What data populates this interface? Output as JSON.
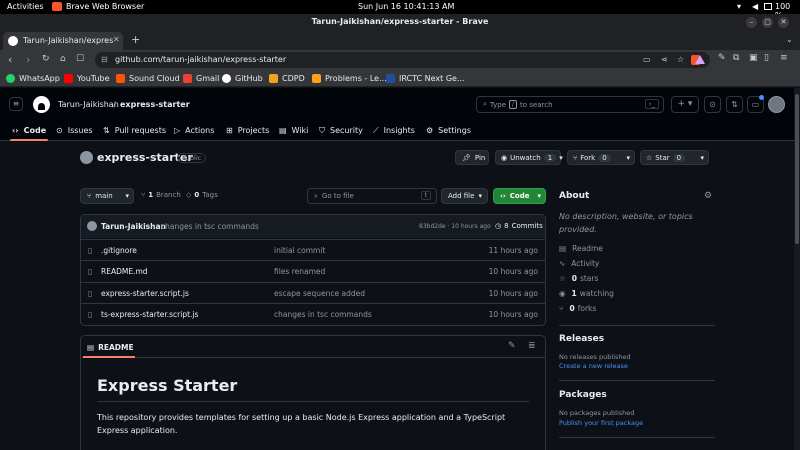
{
  "os_bar": {
    "activities": "Activities",
    "app_name": "Brave Web Browser",
    "datetime": "Sun Jun 16  10:41:13 AM",
    "battery": "100 %"
  },
  "browser": {
    "window_title": "Tarun-Jaikishan/express-starter - Brave",
    "tab_title": "Tarun-Jaikishan/expres",
    "url": "github.com/tarun-jaikishan/express-starter",
    "bookmarks": [
      "WhatsApp",
      "YouTube",
      "Sound Cloud",
      "Gmail",
      "GitHub",
      "CDPD",
      "Problems - Le...",
      "IRCTC Next Ge..."
    ],
    "bookmark_colors": [
      "#25d366",
      "#ff0000",
      "#ff5500",
      "#ea4335",
      "#ffffff",
      "#f4a21b",
      "#ffa116",
      "#1f4e9c"
    ]
  },
  "github": {
    "owner": "Tarun-Jaikishan",
    "separator": "/",
    "repo": "express-starter",
    "search_placeholder_a": "Type",
    "search_key": "/",
    "search_placeholder_b": "to search",
    "repo_tabs": [
      "Code",
      "Issues",
      "Pull requests",
      "Actions",
      "Projects",
      "Wiki",
      "Security",
      "Insights",
      "Settings"
    ],
    "repo_title": "express-starter",
    "visibility": "Public",
    "pin_label": "Pin",
    "unwatch_label": "Unwatch",
    "watch_count": "1",
    "fork_label": "Fork",
    "fork_count": "0",
    "star_label": "Star",
    "star_count": "0",
    "branch_name": "main",
    "branch_count": "1",
    "branch_label": "Branch",
    "tag_count": "0",
    "tag_label": "Tags",
    "goto_placeholder": "Go to file",
    "goto_key": "t",
    "add_file_label": "Add file",
    "code_label": "Code",
    "commit": {
      "author": "Tarun-Jaikishan",
      "message": "changes in tsc commands",
      "hash_time": "83bd2de · 10 hours ago",
      "commit_count": "8",
      "commits_label": "Commits"
    },
    "files": [
      {
        "name": ".gitignore",
        "message": "initial commit",
        "age": "11 hours ago"
      },
      {
        "name": "README.md",
        "message": "files renamed",
        "age": "10 hours ago"
      },
      {
        "name": "express-starter.script.js",
        "message": "escape sequence added",
        "age": "10 hours ago"
      },
      {
        "name": "ts-express-starter.script.js",
        "message": "changes in tsc commands",
        "age": "10 hours ago"
      }
    ],
    "readme_tab": "README",
    "readme_title": "Express Starter",
    "readme_body": "This repository provides templates for setting up a basic Node.js Express application and a TypeScript Express application.",
    "about": {
      "heading": "About",
      "description": "No description, website, or topics provided.",
      "readme": "Readme",
      "activity": "Activity",
      "stars": "0",
      "stars_label": "stars",
      "watching": "1",
      "watching_label": "watching",
      "forks": "0",
      "forks_label": "forks"
    },
    "releases": {
      "heading": "Releases",
      "empty": "No releases published",
      "create": "Create a new release"
    },
    "packages": {
      "heading": "Packages",
      "empty": "No packages published",
      "publish": "Publish your first package"
    },
    "colors": {
      "code_button": "#238636",
      "link": "#4493f8",
      "active_tab_underline": "#f78166"
    }
  }
}
